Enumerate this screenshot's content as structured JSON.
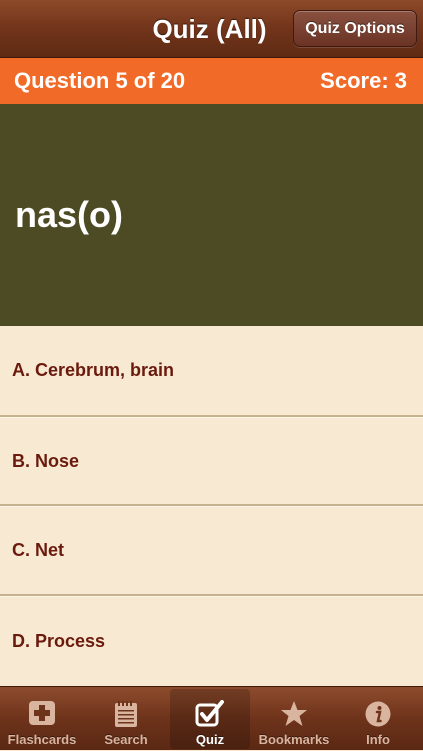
{
  "navbar": {
    "title": "Quiz (All)",
    "options_button": "Quiz Options"
  },
  "status": {
    "question": "Question 5 of 20",
    "score": "Score: 3"
  },
  "term": "nas(o)",
  "answers": [
    {
      "label": "A. Cerebrum, brain"
    },
    {
      "label": "B. Nose"
    },
    {
      "label": "C. Net"
    },
    {
      "label": "D. Process"
    }
  ],
  "tabs": [
    {
      "label": "Flashcards",
      "icon": "plus-card-icon",
      "active": false
    },
    {
      "label": "Search",
      "icon": "notepad-icon",
      "active": false
    },
    {
      "label": "Quiz",
      "icon": "checkbox-icon",
      "active": true
    },
    {
      "label": "Bookmarks",
      "icon": "star-icon",
      "active": false
    },
    {
      "label": "Info",
      "icon": "info-icon",
      "active": false
    }
  ],
  "colors": {
    "status_bar": "#f26a27",
    "term_background": "#4d4b23",
    "answer_background": "#f8ead2",
    "answer_text": "#6b1a0e"
  }
}
